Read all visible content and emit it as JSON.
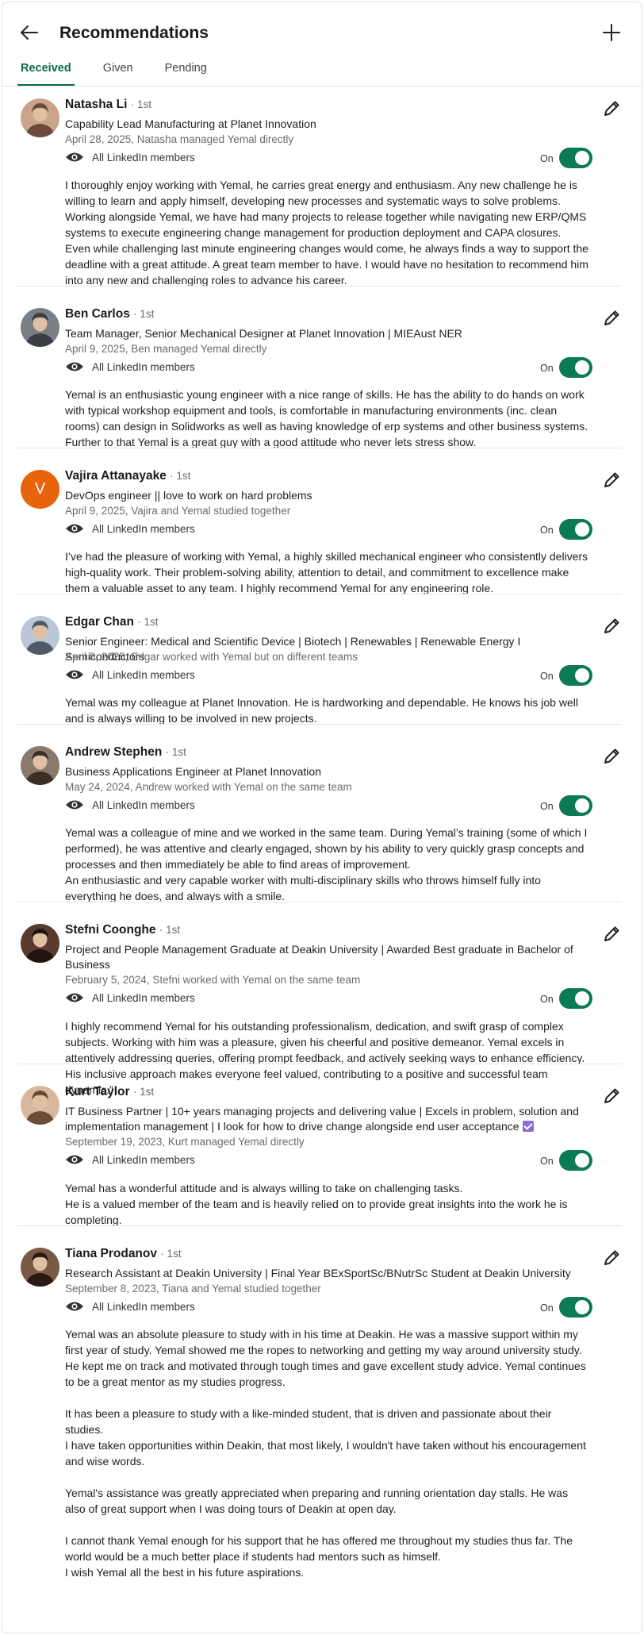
{
  "header": {
    "title": "Recommendations"
  },
  "tabs": [
    {
      "label": "Received",
      "active": true
    },
    {
      "label": "Given",
      "active": false
    },
    {
      "label": "Pending",
      "active": false
    }
  ],
  "colors": {
    "accent": "#0b6b4a",
    "toggle_on": "#0b7a55",
    "orange_avatar": "#e8630a",
    "verified_badge": "#8f6bd3"
  },
  "recommendations": [
    {
      "name": "Natasha Li",
      "degree": "· 1st",
      "headline": "Capability Lead Manufacturing at Planet Innovation",
      "meta": "April 28, 2025, Natasha managed Yemal directly",
      "visibility": "All LinkedIn members",
      "toggle_label": "On",
      "toggle_on": true,
      "body": [
        "I thoroughly enjoy working with Yemal, he carries great energy and enthusiasm. Any new challenge he is willing to learn and apply himself, developing new processes and systematic ways to solve problems. Working alongside Yemal, we have had many projects to release together while navigating new ERP/QMS systems to execute engineering change management for production deployment and CAPA closures. Even while challenging last minute engineering changes would come, he always finds a way to support the deadline with a great attitude. A great team member to have. I would have no hesitation to recommend him into any new and challenging roles to advance his career."
      ]
    },
    {
      "name": "Ben Carlos",
      "degree": "· 1st",
      "headline": "Team Manager, Senior Mechanical Designer at Planet Innovation | MIEAust NER",
      "meta": "April 9, 2025, Ben managed Yemal directly",
      "visibility": "All LinkedIn members",
      "toggle_label": "On",
      "toggle_on": true,
      "body": [
        "Yemal is an enthusiastic young engineer with a nice range of skills. He has the ability to do hands on work with typical workshop equipment and tools, is comfortable in manufacturing environments (inc. clean rooms) can design in Solidworks as well as having knowledge of erp systems and other business systems. Further to that Yemal is a great guy with a good attitude who never lets stress show."
      ]
    },
    {
      "name": "Vajira Attanayake",
      "degree": "· 1st",
      "avatar_letter": "V",
      "headline": "DevOps engineer || love to work on hard problems",
      "meta": "April 9, 2025, Vajira and Yemal studied together",
      "visibility": "All LinkedIn members",
      "toggle_label": "On",
      "toggle_on": true,
      "body": [
        "I’ve had the pleasure of working with Yemal, a highly skilled mechanical engineer who consistently delivers high-quality work. Their problem-solving ability, attention to detail, and commitment to excellence make them a valuable asset to any team. I highly recommend Yemal for any engineering role."
      ]
    },
    {
      "name": "Edgar Chan",
      "degree": "· 1st",
      "headline": "Senior Engineer: Medical and Scientific Device | Biotech | Renewables | Renewable Energy I Semiconductors",
      "meta": "April 8, 2025, Edgar worked with Yemal but on different teams",
      "visibility": "All LinkedIn members",
      "toggle_label": "On",
      "toggle_on": true,
      "body": [
        "Yemal was my colleague at Planet Innovation. He is hardworking and dependable. He knows his job well and is always willing to be involved in new projects."
      ]
    },
    {
      "name": "Andrew Stephen",
      "degree": "· 1st",
      "headline": "Business Applications Engineer at Planet Innovation",
      "meta": "May 24, 2024, Andrew worked with Yemal on the same team",
      "visibility": "All LinkedIn members",
      "toggle_label": "On",
      "toggle_on": true,
      "body": [
        "Yemal was a colleague of mine and we worked in the same team. During Yemal’s training (some of which I performed), he was attentive and clearly engaged, shown by his ability to very quickly grasp concepts and processes and then immediately be able to find areas of improvement.",
        "An enthusiastic and very capable worker with multi-disciplinary skills who throws himself fully into everything he does, and always with a smile."
      ]
    },
    {
      "name": "Stefni Coonghe",
      "degree": "· 1st",
      "headline": "Project and People Management Graduate at Deakin University | Awarded Best graduate in Bachelor of Business",
      "meta": "February 5, 2024, Stefni worked with Yemal on the same team",
      "visibility": "All LinkedIn members",
      "toggle_label": "On",
      "toggle_on": true,
      "body": [
        "I highly recommend Yemal for his outstanding professionalism, dedication, and swift grasp of complex subjects. Working with him was a pleasure, given his cheerful and positive demeanor. Yemal excels in attentively addressing queries, offering prompt feedback, and actively seeking ways to enhance efficiency. His inclusive approach makes everyone feel valued, contributing to a positive and successful team dynamic.”"
      ]
    },
    {
      "name": "Kurt Taylor",
      "degree": "· 1st",
      "headline": "IT Business Partner | 10+ years managing projects and delivering value | Excels in problem, solution and implementation management | I look for how to drive change alongside end user acceptance",
      "meta": "September 19, 2023, Kurt managed Yemal directly",
      "visibility": "All LinkedIn members",
      "toggle_label": "On",
      "toggle_on": true,
      "body": [
        "Yemal has a wonderful attitude and is always willing to take on challenging tasks.",
        "He is a valued member of the team and is heavily relied on to provide great insights into the work he is completing."
      ]
    },
    {
      "name": "Tiana Prodanov",
      "degree": "· 1st",
      "headline": "Research Assistant at Deakin University | Final Year BExSportSc/BNutrSc Student at Deakin University",
      "meta": "September 8, 2023, Tiana and Yemal studied together",
      "visibility": "All LinkedIn members",
      "toggle_label": "On",
      "toggle_on": true,
      "body": [
        "Yemal was an absolute pleasure to study with in his time at Deakin. He was a massive support within my first year of study. Yemal showed me the ropes to networking and getting my way around university study. He kept me on track and motivated through tough times and gave excellent study advice. Yemal continues to be a great mentor as my studies progress.",
        "It has been a pleasure to study with a like-minded student, that is driven and passionate about their studies.",
        "I have taken opportunities within Deakin, that most likely, I wouldn't have taken without his encouragement and wise words.",
        "Yemal's assistance was greatly appreciated when preparing and running orientation day stalls. He was also of great support when I was doing tours of Deakin at open day.",
        "I cannot thank Yemal enough for his support that he has offered me throughout my studies thus far. The world would be a much better place if students had mentors such as himself.",
        "I wish Yemal all the best in his future aspirations."
      ]
    }
  ]
}
